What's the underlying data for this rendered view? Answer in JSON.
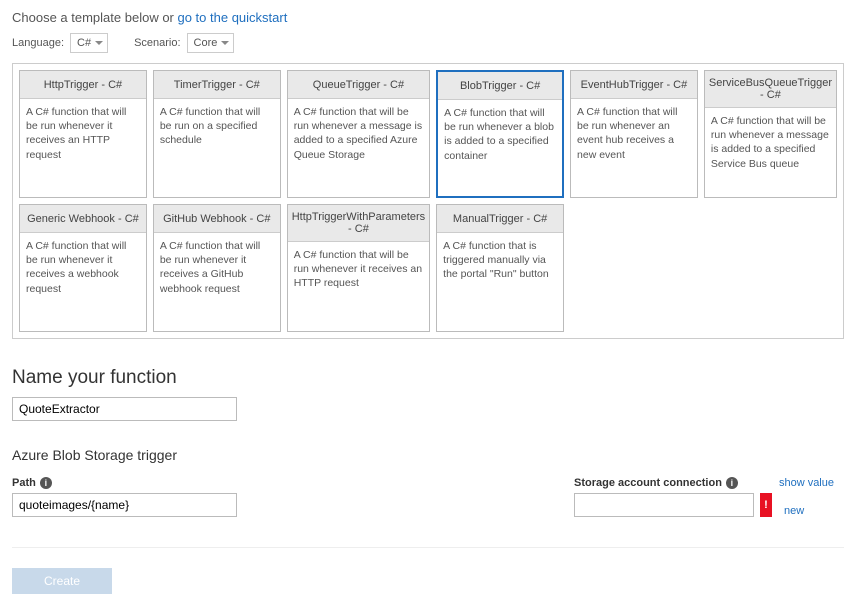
{
  "intro": {
    "prefix": "Choose a template below or ",
    "link": "go to the quickstart"
  },
  "filters": {
    "language_label": "Language:",
    "language_value": "C#",
    "scenario_label": "Scenario:",
    "scenario_value": "Core"
  },
  "templates": [
    {
      "title": "HttpTrigger - C#",
      "desc": "A C# function that will be run whenever it receives an HTTP request",
      "selected": false
    },
    {
      "title": "TimerTrigger - C#",
      "desc": "A C# function that will be run on a specified schedule",
      "selected": false
    },
    {
      "title": "QueueTrigger - C#",
      "desc": "A C# function that will be run whenever a message is added to a specified Azure Queue Storage",
      "selected": false
    },
    {
      "title": "BlobTrigger - C#",
      "desc": "A C# function that will be run whenever a blob is added to a specified container",
      "selected": true
    },
    {
      "title": "EventHubTrigger - C#",
      "desc": "A C# function that will be run whenever an event hub receives a new event",
      "selected": false
    },
    {
      "title": "ServiceBusQueueTrigger - C#",
      "desc": "A C# function that will be run whenever a message is added to a specified Service Bus queue",
      "selected": false
    },
    {
      "title": "Generic Webhook - C#",
      "desc": "A C# function that will be run whenever it receives a webhook request",
      "selected": false
    },
    {
      "title": "GitHub Webhook - C#",
      "desc": "A C# function that will be run whenever it receives a GitHub webhook request",
      "selected": false
    },
    {
      "title": "HttpTriggerWithParameters - C#",
      "desc": "A C# function that will be run whenever it receives an HTTP request",
      "selected": false
    },
    {
      "title": "ManualTrigger - C#",
      "desc": "A C# function that is triggered manually via the portal \"Run\" button",
      "selected": false
    }
  ],
  "name_section": {
    "heading": "Name your function",
    "value": "QuoteExtractor"
  },
  "trigger_section": {
    "heading": "Azure Blob Storage trigger",
    "path_label": "Path",
    "path_value": "quoteimages/{name}",
    "conn_label": "Storage account connection",
    "show_value_link": "show value",
    "new_link": "new",
    "error_glyph": "!"
  },
  "create_label": "Create"
}
